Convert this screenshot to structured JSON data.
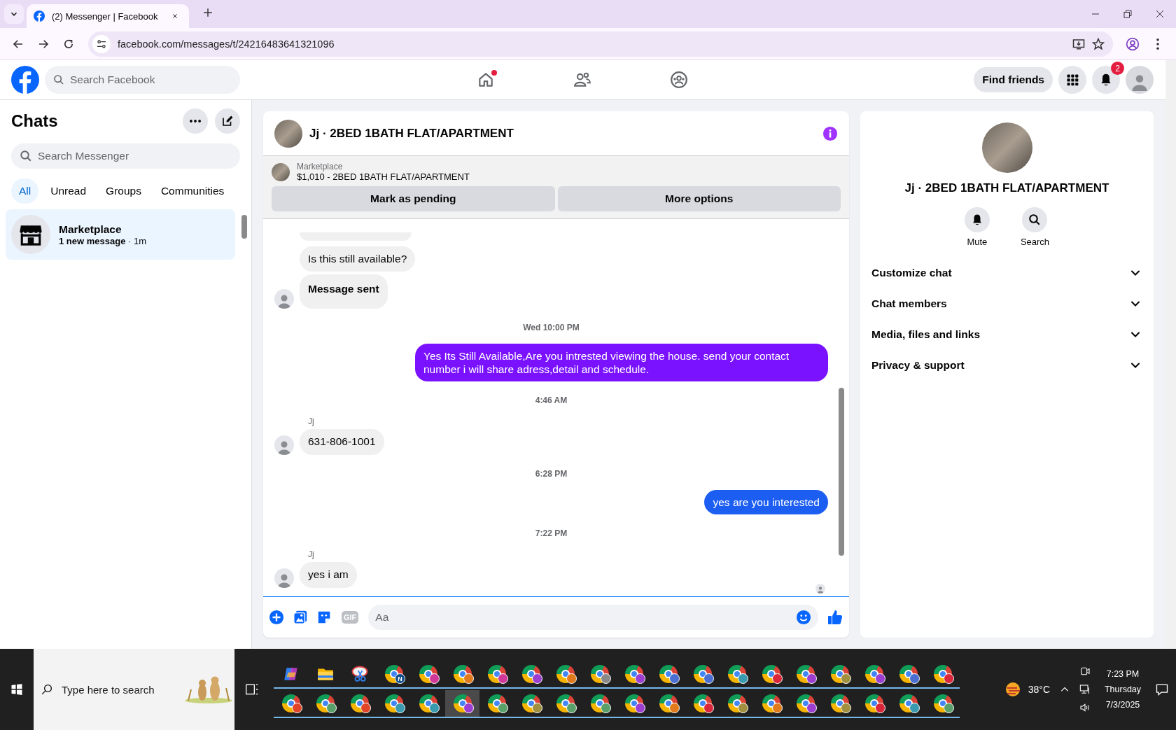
{
  "browser": {
    "tab": {
      "title": "(2) Messenger | Facebook"
    },
    "url": "facebook.com/messages/t/24216483641321096"
  },
  "header": {
    "search": {
      "placeholder": "Search Facebook"
    },
    "nav": [
      {
        "kind": "home",
        "dot": true
      },
      {
        "kind": "friends",
        "dot": false
      },
      {
        "kind": "groups",
        "dot": false
      }
    ],
    "find_friends": "Find friends",
    "notifications": "2"
  },
  "sidebar": {
    "title": "Chats",
    "search": {
      "placeholder": "Search Messenger"
    },
    "filters": [
      {
        "label": "All",
        "selected": true
      },
      {
        "label": "Unread",
        "selected": false
      },
      {
        "label": "Groups",
        "selected": false
      },
      {
        "label": "Communities",
        "selected": false
      }
    ],
    "chats": [
      {
        "name": "Marketplace",
        "preview": "**1 new message** · 1m",
        "selected": true
      }
    ]
  },
  "chat": {
    "title": "Jj · 2BED 1BATH FLAT/APARTMENT",
    "listing": {
      "source": "Marketplace",
      "item": "$1,010 - 2BED 1BATH FLAT/APARTMENT",
      "actions": [
        "Mark as pending",
        "More options"
      ]
    },
    "messages": [
      {
        "kind": "clipped"
      },
      {
        "kind": "incoming",
        "text": "Is this still available?",
        "avatar": false,
        "bold": false
      },
      {
        "kind": "incoming",
        "text": "Message sent",
        "avatar": true,
        "bold": true
      },
      {
        "kind": "time",
        "text": "Wed 10:00 PM"
      },
      {
        "kind": "outgoing",
        "text": "Yes Its Still Available,Are you intrested viewing the house. send your contact number i will share adress,detail and schedule.",
        "color": "#7a12ff"
      },
      {
        "kind": "time",
        "text": "4:46 AM"
      },
      {
        "kind": "incoming",
        "sender": "Jj",
        "text": "631-806-1001",
        "avatar": true,
        "bold": false
      },
      {
        "kind": "time",
        "text": "6:28 PM"
      },
      {
        "kind": "outgoing",
        "text": "yes are you interested",
        "color": "#1c5df2"
      },
      {
        "kind": "time",
        "text": "7:22 PM"
      },
      {
        "kind": "incoming",
        "sender": "Jj",
        "text": "yes i am",
        "avatar": true,
        "bold": false
      }
    ],
    "seen": true,
    "composer": {
      "gif": "GIF",
      "placeholder": "Aa"
    }
  },
  "details": {
    "title": "Jj · 2BED 1BATH FLAT/APARTMENT",
    "actions": [
      "Mute",
      "Search"
    ],
    "sections": [
      {
        "label": "Customize chat",
        "expanded": false
      },
      {
        "label": "Chat members",
        "expanded": false
      },
      {
        "label": "Media, files and links",
        "expanded": false
      },
      {
        "label": "Privacy & support",
        "expanded": false
      }
    ]
  },
  "taskbar": {
    "search": {
      "placeholder": "Type here to search"
    },
    "rows": [
      {
        "items": [
          {
            "kind": "copilot",
            "selected": false
          },
          {
            "kind": "folder",
            "selected": false
          },
          {
            "kind": "snip",
            "selected": false
          },
          {
            "kind": "chrome",
            "label": "N",
            "color": "#0f4c8a",
            "selected": false
          },
          {
            "kind": "chrome",
            "color": "#d0389a",
            "selected": false
          },
          {
            "kind": "chrome",
            "color": "#e07a1a",
            "selected": false
          },
          {
            "kind": "chrome",
            "color": "#d0389a",
            "selected": false
          },
          {
            "kind": "chrome",
            "color": "#9c3fd0",
            "selected": false
          },
          {
            "kind": "chrome",
            "color": "#e07a1a",
            "selected": false
          },
          {
            "kind": "chrome",
            "color": "#8a8a8a",
            "selected": false
          },
          {
            "kind": "chrome",
            "color": "#9c3fd0",
            "selected": false
          },
          {
            "kind": "chrome",
            "color": "#4a6fd0",
            "selected": false
          },
          {
            "kind": "chrome",
            "color": "#4a6fd0",
            "selected": false
          },
          {
            "kind": "chrome",
            "color": "#3a9ab0",
            "selected": false
          },
          {
            "kind": "chrome",
            "color": "#d8263a",
            "selected": false
          },
          {
            "kind": "chrome",
            "color": "#9c3fd0",
            "selected": false
          },
          {
            "kind": "chrome",
            "color": "#a09040",
            "selected": false
          },
          {
            "kind": "chrome",
            "color": "#9c3fd0",
            "selected": false
          },
          {
            "kind": "chrome",
            "color": "#4a6fd0",
            "selected": false
          },
          {
            "kind": "chrome",
            "color": "#d8263a",
            "selected": false
          }
        ]
      },
      {
        "items": [
          {
            "kind": "chrome",
            "color": "#e0452a",
            "selected": false
          },
          {
            "kind": "chrome",
            "color": "#5aa06a",
            "selected": false
          },
          {
            "kind": "chrome",
            "color": "#e0452a",
            "selected": false
          },
          {
            "kind": "chrome",
            "color": "#3a9ab0",
            "selected": false
          },
          {
            "kind": "chrome",
            "color": "#3a9ab0",
            "selected": false
          },
          {
            "kind": "chrome",
            "color": "#9c3fd0",
            "selected": true
          },
          {
            "kind": "chrome",
            "color": "#5aa06a",
            "selected": false
          },
          {
            "kind": "chrome",
            "color": "#a09040",
            "selected": false
          },
          {
            "kind": "chrome",
            "color": "#5aa06a",
            "selected": false
          },
          {
            "kind": "chrome",
            "color": "#5aa06a",
            "selected": false
          },
          {
            "kind": "chrome",
            "color": "#9c3fd0",
            "selected": false
          },
          {
            "kind": "chrome",
            "color": "#e07a1a",
            "selected": false
          },
          {
            "kind": "chrome",
            "color": "#d8263a",
            "selected": false
          },
          {
            "kind": "chrome",
            "color": "#a09040",
            "selected": false
          },
          {
            "kind": "chrome",
            "color": "#e07a1a",
            "selected": false
          },
          {
            "kind": "chrome",
            "color": "#9c3fd0",
            "selected": false
          },
          {
            "kind": "chrome",
            "color": "#a09040",
            "selected": false
          },
          {
            "kind": "chrome",
            "color": "#d8263a",
            "selected": false
          },
          {
            "kind": "chrome",
            "color": "#3a9ab0",
            "selected": false
          },
          {
            "kind": "chrome",
            "color": "#5aa06a",
            "selected": false
          }
        ]
      }
    ],
    "weather": "38°C",
    "time": "7:23 PM",
    "day": "Thursday",
    "date": "7/3/2025"
  }
}
